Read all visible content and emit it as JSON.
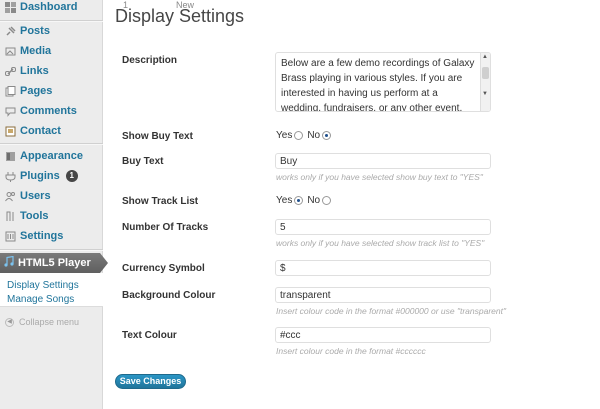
{
  "top_fragments": [
    "1",
    "New"
  ],
  "sidebar": {
    "items": [
      {
        "label": "Dashboard",
        "icon": "dashboard-icon"
      },
      {
        "label": "Posts",
        "icon": "pushpin-icon"
      },
      {
        "label": "Media",
        "icon": "media-icon"
      },
      {
        "label": "Links",
        "icon": "link-icon"
      },
      {
        "label": "Pages",
        "icon": "pages-icon"
      },
      {
        "label": "Comments",
        "icon": "comment-bubble-icon"
      },
      {
        "label": "Contact",
        "icon": "contact-icon"
      },
      {
        "label": "Appearance",
        "icon": "appearance-icon"
      },
      {
        "label": "Plugins",
        "icon": "plugin-icon",
        "badge": "1"
      },
      {
        "label": "Users",
        "icon": "users-icon"
      },
      {
        "label": "Tools",
        "icon": "tools-icon"
      },
      {
        "label": "Settings",
        "icon": "settings-icon"
      }
    ],
    "current": {
      "label": "HTML5 Player",
      "icon": "music-note-icon"
    },
    "submenu": [
      "Display Settings",
      "Manage Songs"
    ],
    "collapse_label": "Collapse menu"
  },
  "page": {
    "title": "Display Settings",
    "fields": {
      "description": {
        "label": "Description",
        "value": "Below are a few demo recordings of Galaxy Brass playing in various styles. If you are interested in having us perform at a wedding, fundraisers, or any other event, please contact us to discuss the type of"
      },
      "show_buy_text": {
        "label": "Show Buy Text",
        "yes": "Yes",
        "no": "No",
        "selected": "No"
      },
      "buy_text": {
        "label": "Buy Text",
        "value": "Buy",
        "hint": "works only if you have selected show buy text to \"YES\""
      },
      "show_track_list": {
        "label": "Show Track List",
        "yes": "Yes",
        "no": "No",
        "selected": "Yes"
      },
      "number_of_tracks": {
        "label": "Number Of Tracks",
        "value": "5",
        "hint": "works only if you have selected show track list to \"YES\""
      },
      "currency_symbol": {
        "label": "Currency Symbol",
        "value": "$"
      },
      "background_colour": {
        "label": "Background Colour",
        "value": "transparent",
        "hint": "Insert colour code in the format #000000 or use \"transparent\""
      },
      "text_colour": {
        "label": "Text Colour",
        "value": "#ccc",
        "hint": "Insert colour code in the format #cccccc"
      }
    },
    "save_label": "Save Changes"
  },
  "colors": {
    "link": "#21759b",
    "button": "#21759b",
    "current_menu": "#6d6d6d"
  }
}
